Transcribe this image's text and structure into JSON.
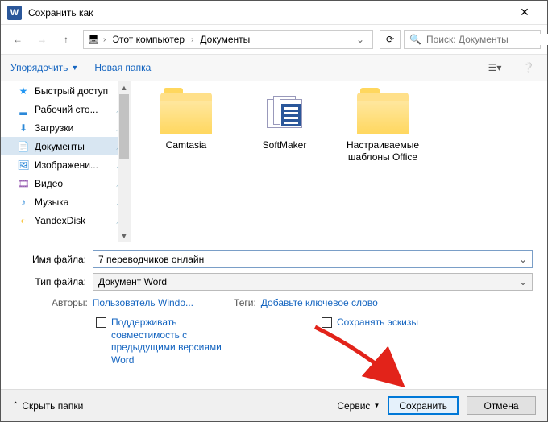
{
  "title": "Сохранить как",
  "breadcrumb": {
    "root": "Этот компьютер",
    "current": "Документы"
  },
  "search": {
    "placeholder": "Поиск: Документы"
  },
  "toolbar": {
    "organize": "Упорядочить",
    "newfolder": "Новая папка"
  },
  "sidebar": {
    "items": [
      {
        "label": "Быстрый доступ"
      },
      {
        "label": "Рабочий сто..."
      },
      {
        "label": "Загрузки"
      },
      {
        "label": "Документы"
      },
      {
        "label": "Изображени..."
      },
      {
        "label": "Видео"
      },
      {
        "label": "Музыка"
      },
      {
        "label": "YandexDisk"
      }
    ]
  },
  "files": [
    {
      "label": "Camtasia"
    },
    {
      "label": "SoftMaker"
    },
    {
      "label": "Настраиваемые шаблоны Office"
    }
  ],
  "fields": {
    "name_label": "Имя файла:",
    "name_value": "7 переводчиков онлайн",
    "type_label": "Тип файла:",
    "type_value": "Документ Word"
  },
  "meta": {
    "authors_label": "Авторы:",
    "authors_value": "Пользователь Windo...",
    "tags_label": "Теги:",
    "tags_value": "Добавьте ключевое слово"
  },
  "checks": {
    "compat": "Поддерживать совместимость с предыдущими версиями Word",
    "thumbs": "Сохранять эскизы"
  },
  "footer": {
    "hide": "Скрыть папки",
    "service": "Сервис",
    "save": "Сохранить",
    "cancel": "Отмена"
  }
}
